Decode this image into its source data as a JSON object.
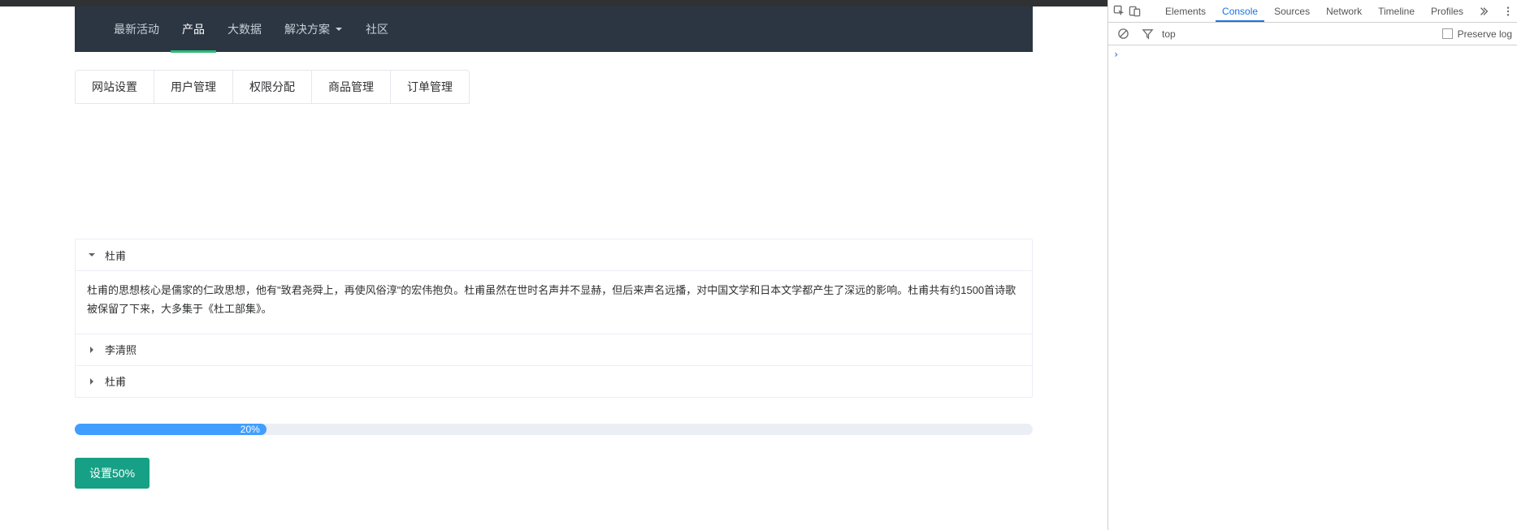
{
  "nav": {
    "items": [
      {
        "label": "最新活动"
      },
      {
        "label": "产品",
        "active": true
      },
      {
        "label": "大数据"
      },
      {
        "label": "解决方案",
        "dropdown": true
      },
      {
        "label": "社区"
      }
    ]
  },
  "tabs": {
    "items": [
      {
        "label": "网站设置",
        "active": true
      },
      {
        "label": "用户管理"
      },
      {
        "label": "权限分配"
      },
      {
        "label": "商品管理"
      },
      {
        "label": "订单管理"
      }
    ]
  },
  "collapse": {
    "items": [
      {
        "title": "杜甫",
        "open": true,
        "body": "杜甫的思想核心是儒家的仁政思想，他有\"致君尧舜上，再使风俗淳\"的宏伟抱负。杜甫虽然在世时名声并不显赫，但后来声名远播，对中国文学和日本文学都产生了深远的影响。杜甫共有约1500首诗歌被保留了下来，大多集于《杜工部集》。"
      },
      {
        "title": "李清照",
        "open": false
      },
      {
        "title": "杜甫",
        "open": false
      }
    ]
  },
  "progress": {
    "percent": 20,
    "text": "20%"
  },
  "button": {
    "label": "设置50%"
  },
  "devtools": {
    "tabs": [
      "Elements",
      "Console",
      "Sources",
      "Network",
      "Timeline",
      "Profiles"
    ],
    "active": "Console",
    "context": "top",
    "preserve_label": "Preserve log",
    "prompt": "›"
  }
}
